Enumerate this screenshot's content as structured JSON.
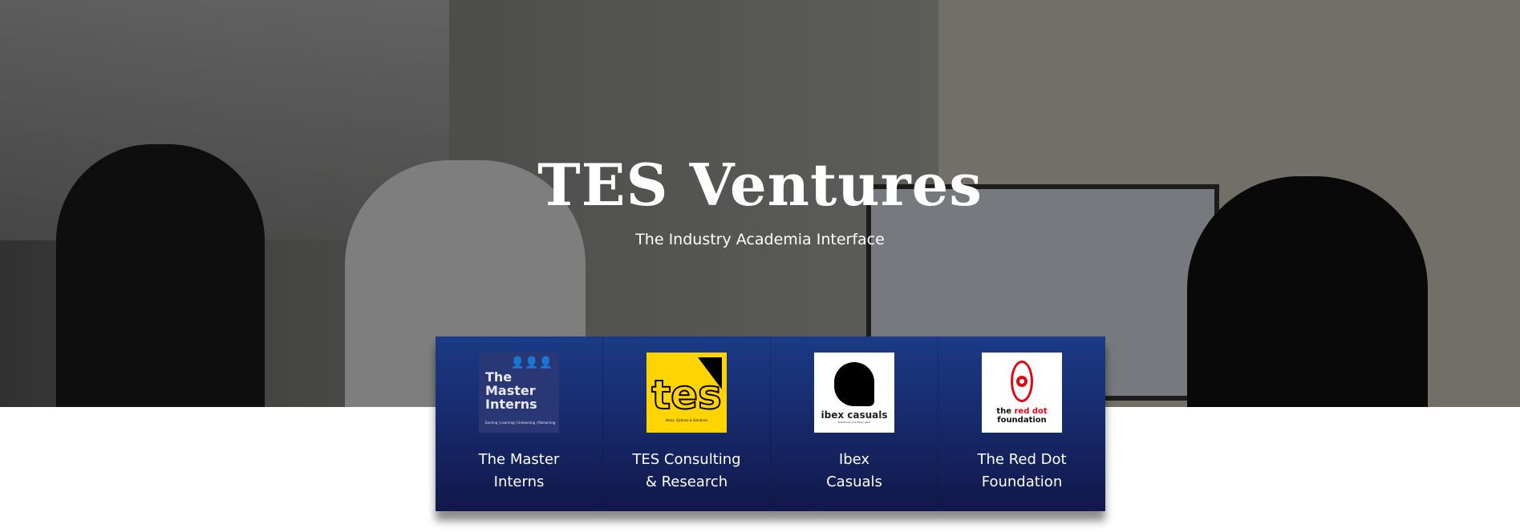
{
  "hero": {
    "title": "TES Ventures",
    "subtitle": "The Industry Academia Interface"
  },
  "ventures": [
    {
      "name_line1": "The Master",
      "name_line2": "Interns",
      "logo_text": "The Master Interns",
      "logo_tagline": "Earning | Learning | Unlearning | Relearning"
    },
    {
      "name_line1": "TES Consulting",
      "name_line2": "& Research",
      "logo_text": "tes",
      "logo_tagline": "Ideas, Options & Solutions"
    },
    {
      "name_line1": "Ibex",
      "name_line2": "Casuals",
      "logo_text": "ibex casuals",
      "logo_tagline": "ambitious | practical | stoic"
    },
    {
      "name_line1": "The Red Dot",
      "name_line2": "Foundation",
      "logo_text": "the red dot foundation",
      "logo_tagline": ""
    }
  ],
  "colors": {
    "panel_top": "#1b3a86",
    "panel_bottom": "#11184a",
    "red": "#e30613",
    "yellow": "#ffd400"
  }
}
